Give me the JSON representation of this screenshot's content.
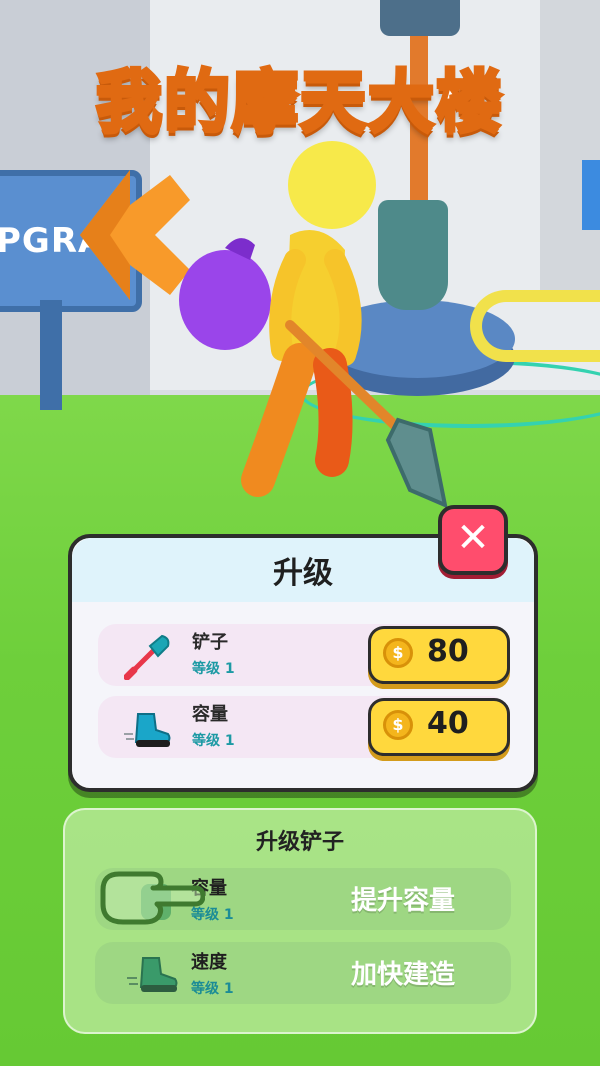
{
  "game": {
    "title": "我的摩天大楼",
    "background_sign": "PGRA"
  },
  "upgrade_panel": {
    "title": "升级",
    "close_icon": "close-x-icon",
    "items": [
      {
        "name": "铲子",
        "level": "等级 1",
        "cost": "80",
        "icon": "shovel-icon"
      },
      {
        "name": "容量",
        "level": "等级 1",
        "cost": "40",
        "icon": "boot-icon"
      }
    ],
    "coin_symbol": "$"
  },
  "tutorial_card": {
    "title": "升级铲子",
    "items": [
      {
        "name": "容量",
        "level": "等级 1",
        "action": "提升容量",
        "icon": "backpack-icon"
      },
      {
        "name": "速度",
        "level": "等级 1",
        "action": "加快建造",
        "icon": "boot-icon"
      }
    ]
  },
  "colors": {
    "title_outline": "#e06a12",
    "close_button": "#ff4d6d",
    "coin_button": "#ffd83d",
    "level_text": "#1c9aa4",
    "grass": "#6ecf3b"
  }
}
